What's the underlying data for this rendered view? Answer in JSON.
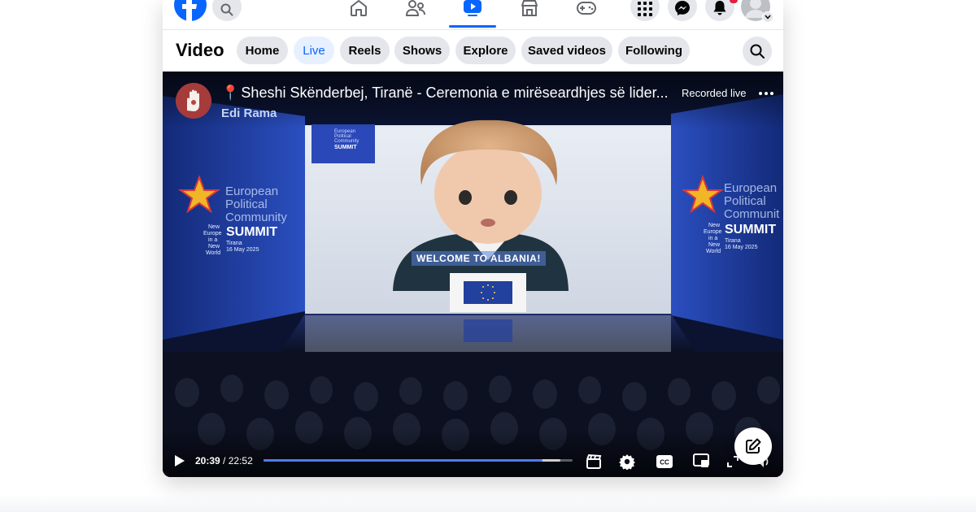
{
  "topnav": {
    "icons": [
      "facebook-logo",
      "search-icon",
      "home-icon",
      "friends-icon",
      "video-icon",
      "marketplace-icon",
      "gaming-icon",
      "menu-grid-icon",
      "messenger-icon",
      "bell-icon",
      "profile-avatar"
    ],
    "active_tab": "video",
    "brand_color": "#0866ff"
  },
  "video_header": {
    "title": "Video",
    "tabs": [
      {
        "label": "Home",
        "active": false
      },
      {
        "label": "Live",
        "active": true
      },
      {
        "label": "Reels",
        "active": false
      },
      {
        "label": "Shows",
        "active": false
      },
      {
        "label": "Explore",
        "active": false
      },
      {
        "label": "Saved videos",
        "active": false
      },
      {
        "label": "Following",
        "active": false
      }
    ]
  },
  "player": {
    "title": "Sheshi Skënderbej, Tiranë - Ceremonia e mirëseardhjes së lider...",
    "channel": "Edi Rama",
    "status": "Recorded live",
    "current_time": "20:39",
    "separator": " / ",
    "duration": "22:52",
    "progress_fraction": 0.902,
    "buffer_fraction": 0.96,
    "scene": {
      "left_screen": {
        "line1": "European",
        "line2": "Political",
        "line3": "Community",
        "summit": "SUMMIT",
        "tagline1": "New",
        "tagline2": "Europe",
        "tagline3": "in a",
        "tagline4": "New",
        "tagline5": "World",
        "city": "Tirana",
        "date": "16 May 2025"
      },
      "right_screen": {
        "line1": "European",
        "line2": "Political",
        "line3": "Communit",
        "summit": "SUMMIT",
        "tagline1": "New",
        "tagline2": "Europe",
        "tagline3": "in a",
        "tagline4": "New",
        "tagline5": "World",
        "city": "Tirana",
        "date": "16 May 2025"
      },
      "mini_badge": {
        "line1": "European",
        "line2": "Political",
        "line3": "Community",
        "summit": "SUMMIT"
      },
      "caption": "WELCOME TO ALBANIA!"
    }
  }
}
